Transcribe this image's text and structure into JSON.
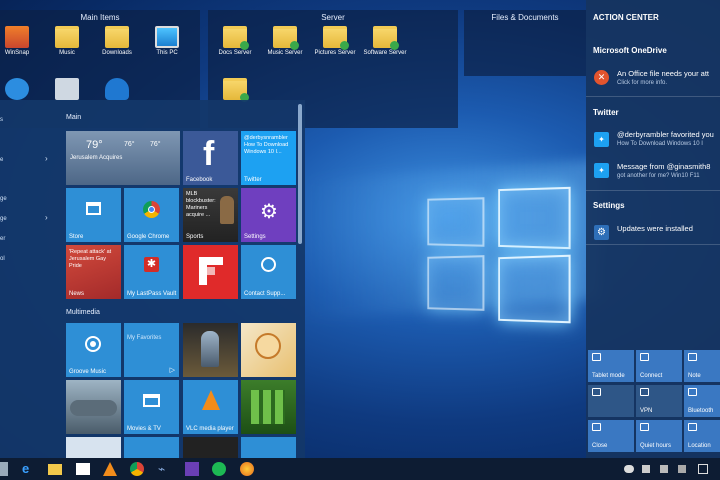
{
  "fences": [
    {
      "title": "Main Items",
      "icons": [
        "WinSnap",
        "Music",
        "Downloads",
        "This PC"
      ]
    },
    {
      "title": "Server",
      "icons": [
        "Docs Server",
        "Music Server",
        "Pictures Server",
        "Software Server"
      ]
    },
    {
      "title": "Files & Documents",
      "icons": []
    }
  ],
  "start": {
    "sections": {
      "main": "Main",
      "multimedia": "Multimedia"
    },
    "left_items": [
      "s",
      "e",
      "ge",
      "ge",
      "er",
      "ol"
    ],
    "tiles": {
      "weather": {
        "temp1": "79°",
        "temp2": "76°",
        "temp3": "76°",
        "place": "Jerusalem Acquires"
      },
      "facebook": {
        "label": "Facebook"
      },
      "twitter": {
        "text": "@derbysnrambler How To Download Windows 10 I...",
        "label": "Twitter"
      },
      "store": {
        "label": "Store"
      },
      "chrome": {
        "label": "Google Chrome"
      },
      "sports": {
        "text": "MLB blockbuster: Mariners acquire ...",
        "label": "Sports"
      },
      "settings": {
        "label": "Settings"
      },
      "news": {
        "text": "'Repeat attack' at Jerusalem Gay Pride",
        "label": "News"
      },
      "lastpass": {
        "label": "My LastPass Vault"
      },
      "flipboard": {
        "label": ""
      },
      "contact": {
        "label": "Contact Supp..."
      },
      "groove": {
        "label": "Groove Music"
      },
      "favorites": {
        "label": "My Favorites"
      },
      "movies": {
        "label": "Movies & TV"
      },
      "vlc": {
        "label": "VLC media player"
      }
    }
  },
  "action_center": {
    "title": "ACTION CENTER",
    "onedrive": {
      "section": "Microsoft OneDrive",
      "line1": "An Office file needs your att",
      "line2": "Click for more info."
    },
    "twitter": {
      "section": "Twitter",
      "n1_line1": "@derbyrambler favorited you",
      "n1_line2": "How To Download Windows 10 I",
      "n2_line1": "Message from @ginasmith8",
      "n2_line2": "got another for me? Win10 F11"
    },
    "settings": {
      "section": "Settings",
      "line1": "Updates were installed"
    },
    "quick_actions": [
      "Tablet mode",
      "Connect",
      "Note",
      "",
      "VPN",
      "Bluetooth",
      "Close",
      "Quiet hours",
      "Location"
    ]
  },
  "colors": {
    "tile_blue": "#2e8fd6",
    "facebook": "#3b5998",
    "settings_purple": "#6f3fbf",
    "news_red": "#c4322c",
    "flipboard": "#e02a2a",
    "twitter": "#1da1f2"
  }
}
